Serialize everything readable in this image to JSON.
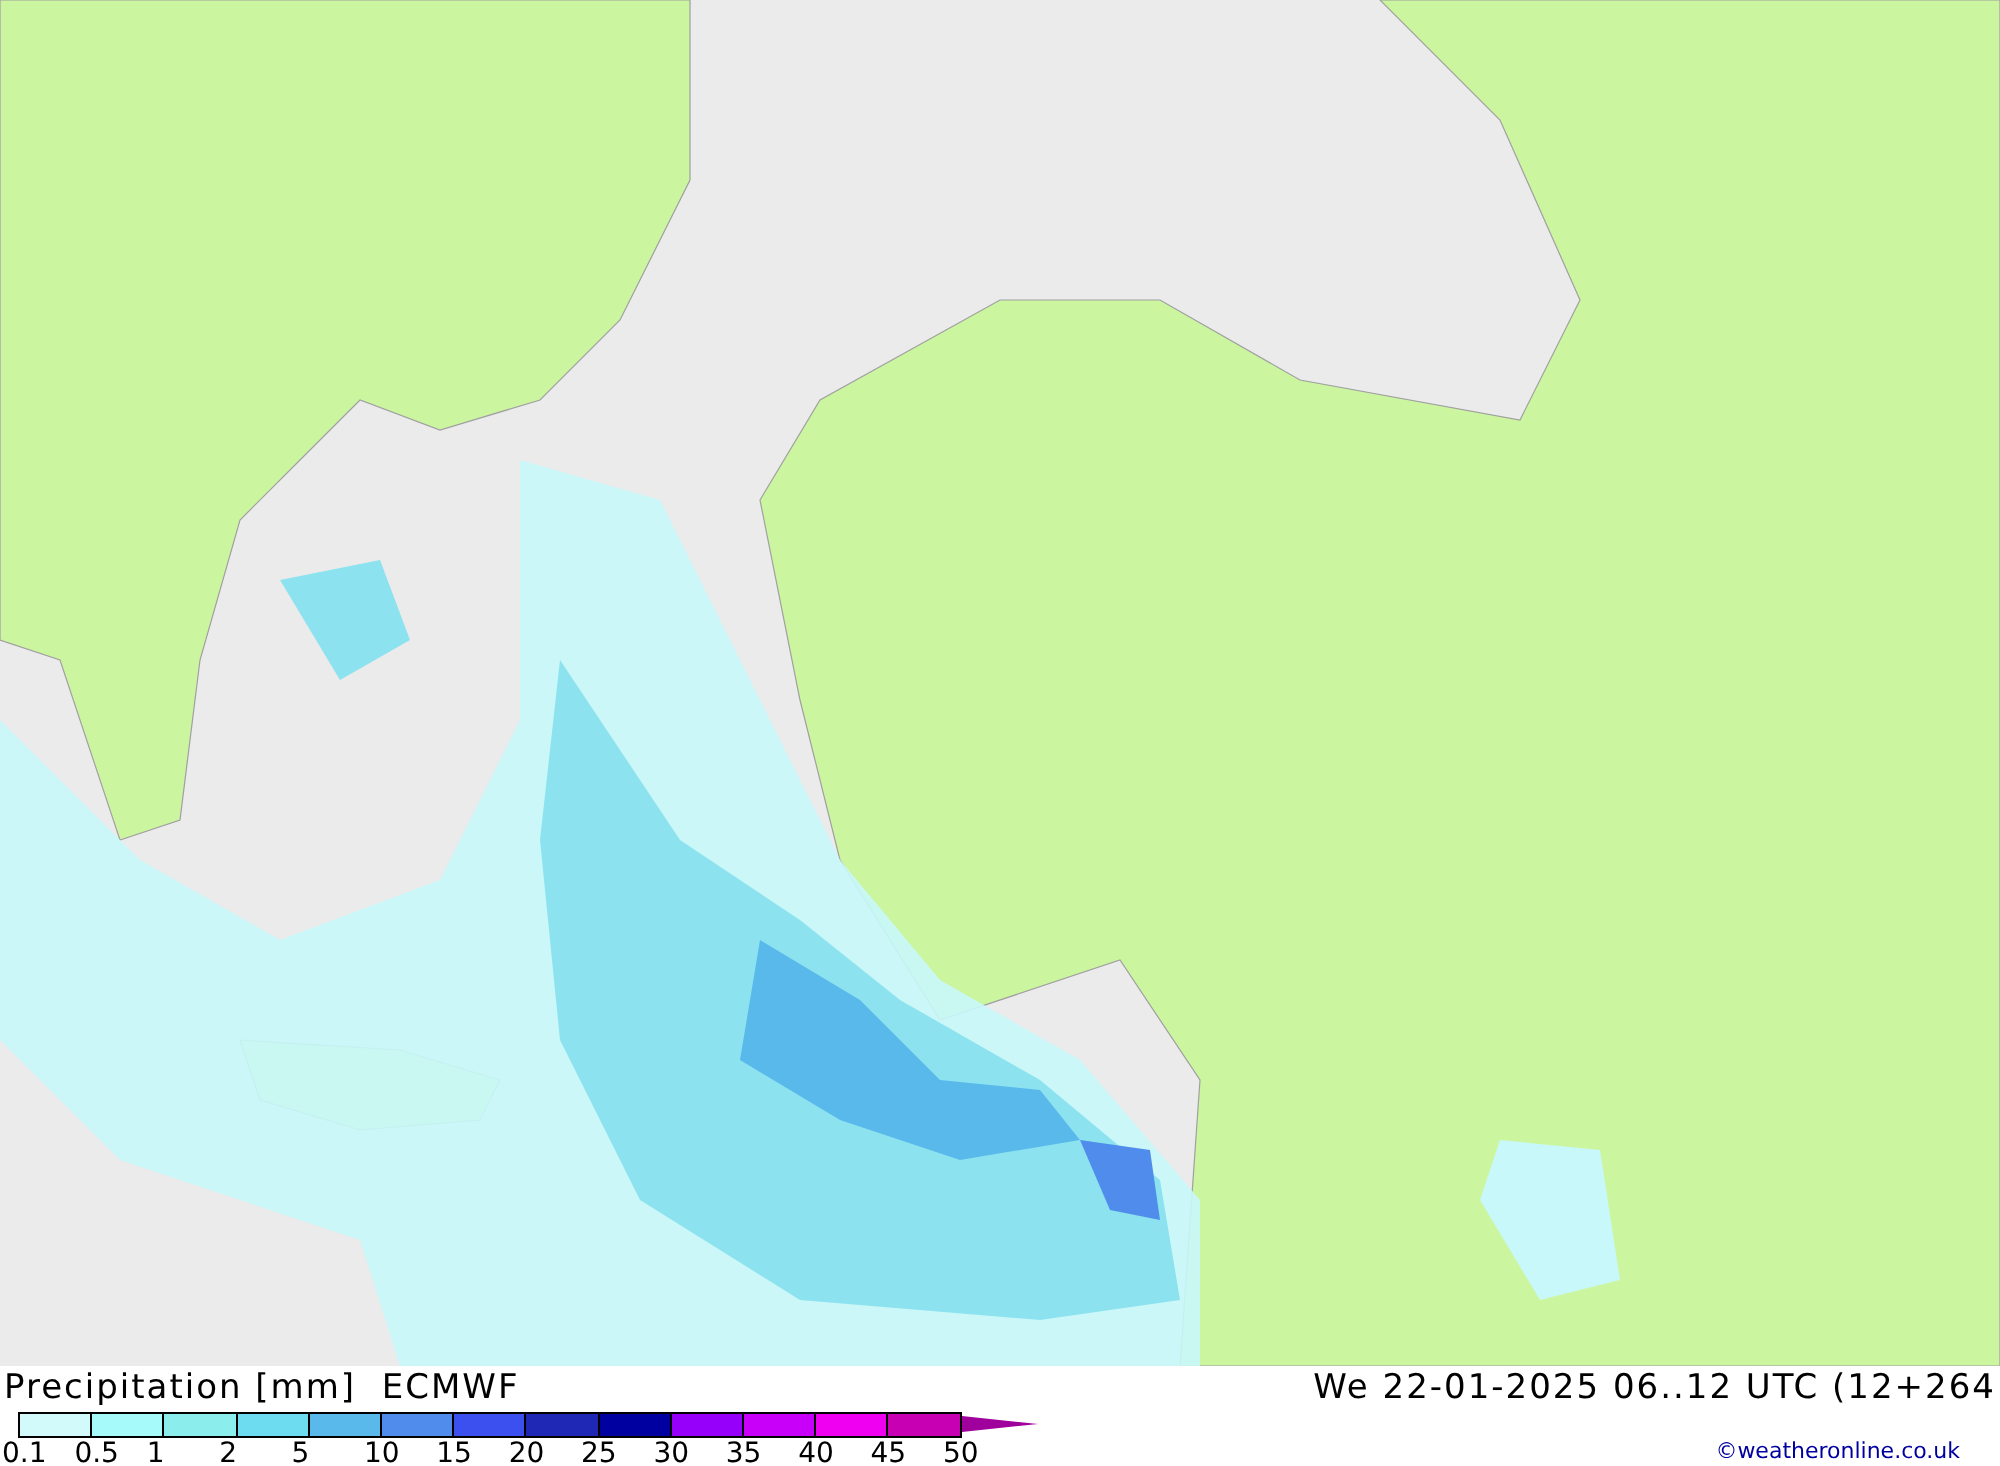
{
  "title": "Precipitation [mm]  ECMWF",
  "valid_time": "We 22-01-2025 06..12 UTC (12+264",
  "legend": {
    "swatches": [
      {
        "color": "#d2fafa"
      },
      {
        "color": "#a6fafa"
      },
      {
        "color": "#8ceded"
      },
      {
        "color": "#6edcf0"
      },
      {
        "color": "#5ab9eb"
      },
      {
        "color": "#508ceb"
      },
      {
        "color": "#3c50f0"
      },
      {
        "color": "#1e28b4"
      },
      {
        "color": "#0000a0"
      },
      {
        "color": "#9600fa"
      },
      {
        "color": "#c800fa"
      },
      {
        "color": "#f000f0"
      },
      {
        "color": "#c800b4"
      },
      {
        "kind": "arrow",
        "color": "#a0009b"
      }
    ],
    "labels": [
      "0.1",
      "0.5",
      "1",
      "2",
      "5",
      "10",
      "15",
      "20",
      "25",
      "30",
      "35",
      "40",
      "45",
      "50"
    ]
  },
  "credit": "©weatheronline.co.uk"
}
